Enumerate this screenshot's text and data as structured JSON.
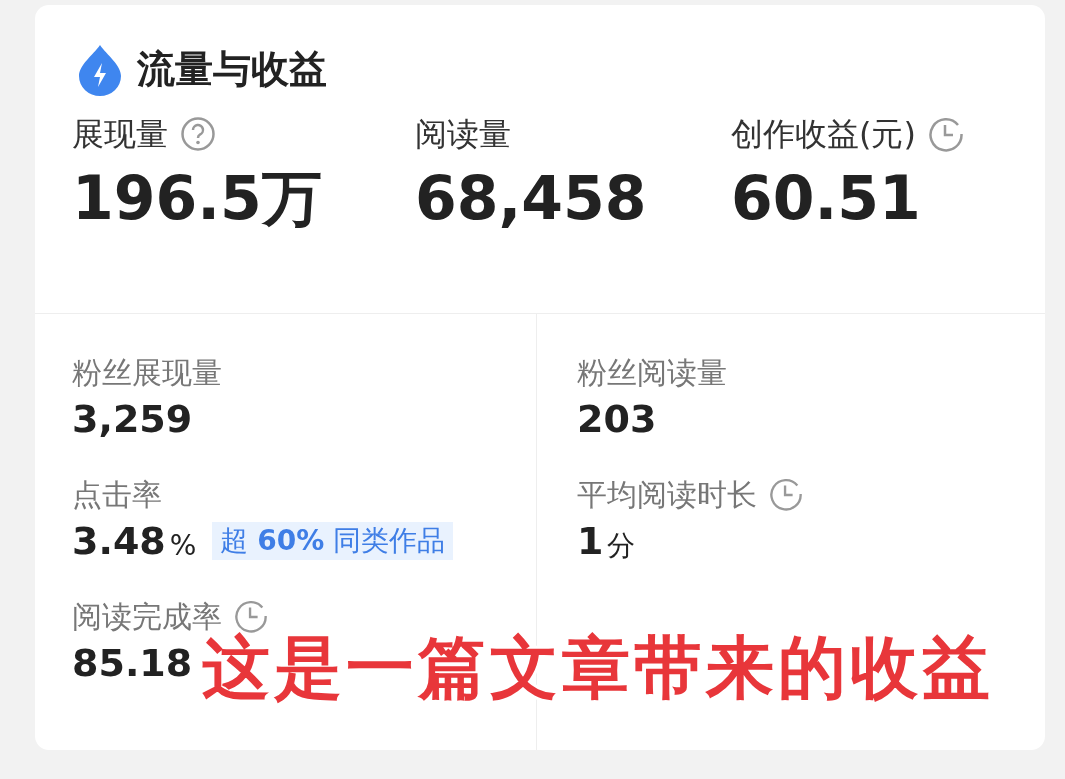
{
  "card": {
    "title": "流量与收益"
  },
  "top_metrics": [
    {
      "label": "展现量",
      "value": "196.5万",
      "kind": "help"
    },
    {
      "label": "阅读量",
      "value": "68,458",
      "kind": "plain"
    },
    {
      "label": "创作收益(元)",
      "value": "60.51",
      "kind": "timed"
    }
  ],
  "detail_columns": [
    [
      {
        "label": "粉丝展现量",
        "value": "3,259",
        "kind": "plain"
      },
      {
        "label": "点击率",
        "value": "3.48",
        "unit": "%",
        "badge": "超 **60%** 同类作品",
        "kind": "plain"
      },
      {
        "label": "阅读完成率",
        "value": "85.18",
        "kind": "timed"
      }
    ],
    [
      {
        "label": "粉丝阅读量",
        "value": "203",
        "kind": "plain"
      },
      {
        "label": "平均阅读时长",
        "value": "1",
        "unit": "分",
        "kind": "timed"
      }
    ]
  ],
  "caption": "这是一篇文章带来的收益"
}
